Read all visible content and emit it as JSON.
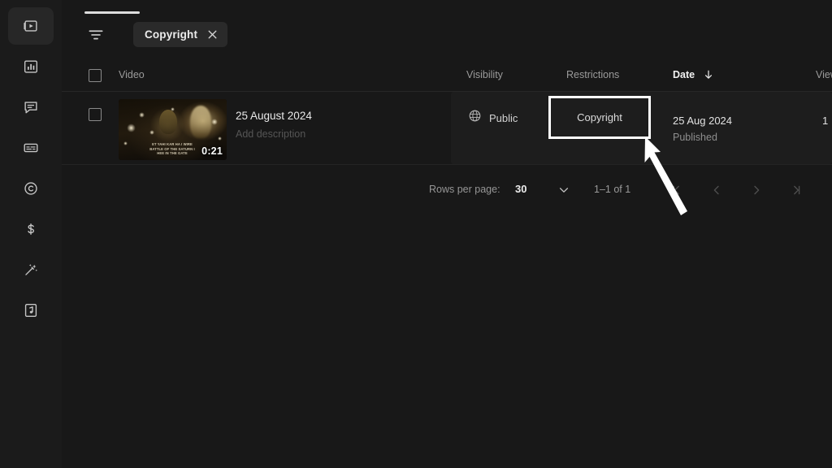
{
  "app": {
    "name": "YouTube Studio",
    "background": "#181818",
    "sidebar_background": "#1b1b1b",
    "highlight_color": "#ffffff"
  },
  "sidebar": {
    "items": [
      {
        "id": "content",
        "icon": "content-video-icon",
        "label": "Content",
        "active": true
      },
      {
        "id": "analytics",
        "icon": "analytics-bar-chart-icon",
        "label": "Analytics",
        "active": false
      },
      {
        "id": "comments",
        "icon": "comments-speech-icon",
        "label": "Comments",
        "active": false
      },
      {
        "id": "subtitles",
        "icon": "subtitles-icon",
        "label": "Subtitles",
        "active": false
      },
      {
        "id": "copyright",
        "icon": "copyright-c-icon",
        "label": "Copyright",
        "active": false
      },
      {
        "id": "earn",
        "icon": "earn-dollar-icon",
        "label": "Earn",
        "active": false
      },
      {
        "id": "customisation",
        "icon": "magic-wand-icon",
        "label": "Customisation",
        "active": false
      },
      {
        "id": "audio-library",
        "icon": "audio-library-note-icon",
        "label": "Audio library",
        "active": false
      }
    ]
  },
  "toolbar": {
    "filter_icon": "filter-icon",
    "filter_chips": [
      {
        "label": "Copyright",
        "remove_icon": "close-x-icon"
      }
    ]
  },
  "table": {
    "select_all_checkbox": false,
    "columns": [
      {
        "key": "video",
        "label": "Video",
        "sorted": false
      },
      {
        "key": "visibility",
        "label": "Visibility",
        "sorted": false
      },
      {
        "key": "restrictions",
        "label": "Restrictions",
        "sorted": false
      },
      {
        "key": "date",
        "label": "Date",
        "sorted": true,
        "sort_direction": "desc",
        "sort_icon": "arrow-down-icon"
      },
      {
        "key": "views",
        "label": "Views",
        "sorted": false
      }
    ],
    "rows": [
      {
        "selected": false,
        "thumbnail": {
          "duration": "0:21",
          "overlay_text": "ET YAHI KAR HA I WIRE\nBATTLE OF THE SATURN I\nHEE IN THE GATE",
          "alt": "video-thumbnail"
        },
        "title": "25 August 2024",
        "description_placeholder": "Add description",
        "visibility": {
          "label": "Public",
          "icon": "globe-public-icon"
        },
        "restrictions": {
          "label": "Copyright",
          "highlighted": true
        },
        "date": {
          "value": "25 Aug 2024",
          "status": "Published"
        },
        "views": "1"
      }
    ]
  },
  "pagination": {
    "rows_per_page_label": "Rows per page:",
    "rows_per_page_value": "30",
    "rows_per_page_chevron": "chevron-down-icon",
    "range_label": "1–1 of 1",
    "buttons": [
      {
        "name": "first-page",
        "icon": "first-page-icon",
        "disabled": true
      },
      {
        "name": "previous-page",
        "icon": "chevron-left-icon",
        "disabled": true
      },
      {
        "name": "next-page",
        "icon": "chevron-right-icon",
        "disabled": true
      },
      {
        "name": "last-page",
        "icon": "last-page-icon",
        "disabled": true
      }
    ]
  },
  "annotation": {
    "arrow": {
      "name": "pointer-arrow",
      "points_to": "Copyright",
      "color": "#ffffff"
    }
  }
}
